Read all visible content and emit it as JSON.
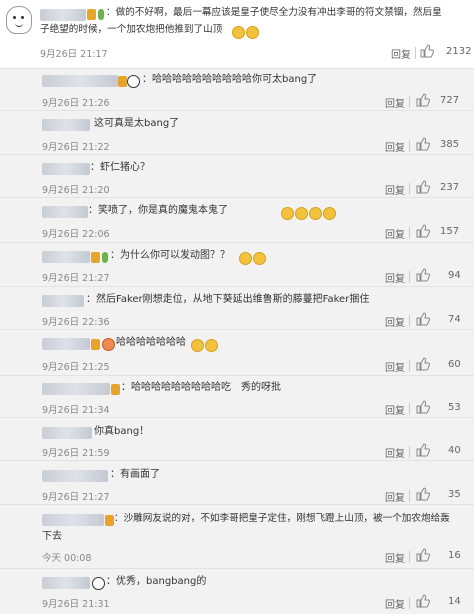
{
  "main_comment": {
    "text_line1": "：做的不好啊，最后一幕应该是皇子使尽全力没有冲出李哥的符文禁锢，然后皇",
    "text_line2": "子绝望的时候，一个加农炮把他推到了山顶",
    "time": "9月26日 21:17",
    "reply_label": "回复",
    "likes": "2132"
  },
  "replies": [
    {
      "text": "：哈哈哈哈哈哈哈哈哈哈你可太bang了",
      "time": "9月26日 21:26",
      "reply_label": "回复",
      "likes": "727"
    },
    {
      "text": "这可真是太bang了",
      "time": "9月26日 21:22",
      "reply_label": "回复",
      "likes": "385"
    },
    {
      "text": "：虾仁猪心？",
      "time": "9月26日 21:20",
      "reply_label": "回复",
      "likes": "237"
    },
    {
      "text": "：笑喷了，你是真的魔鬼本鬼了",
      "time": "9月26日 22:06",
      "reply_label": "回复",
      "likes": "157"
    },
    {
      "text": "：为什么你可以发动图？？",
      "time": "9月26日 21:27",
      "reply_label": "回复",
      "likes": "94"
    },
    {
      "text": "：然后Faker刚想走位，从地下葵延出维鲁斯的藤蔓把Faker捆住",
      "time": "9月26日 22:36",
      "reply_label": "回复",
      "likes": "74"
    },
    {
      "text": "哈哈哈哈哈哈哈",
      "time": "9月26日 21:25",
      "reply_label": "回复",
      "likes": "60"
    },
    {
      "text": "：哈哈哈哈哈哈哈哈哈吃　秀的呀批",
      "time": "9月26日 21:34",
      "reply_label": "回复",
      "likes": "53"
    },
    {
      "text": "你真bang！",
      "time": "9月26日 21:59",
      "reply_label": "回复",
      "likes": "40"
    },
    {
      "text": "：有画面了",
      "time": "9月26日 21:27",
      "reply_label": "回复",
      "likes": "35"
    },
    {
      "text_line1": "：沙雕网友说的对，不如李哥把皇子定住，刚想飞蹬上山顶，被一个加农炮给轰",
      "text_line2": "下去",
      "time": "今天 00:08",
      "reply_label": "回复",
      "likes": "16"
    },
    {
      "text": "：优秀，bangbang的",
      "time": "9月26日 21:31",
      "reply_label": "回复",
      "likes": "14"
    }
  ]
}
